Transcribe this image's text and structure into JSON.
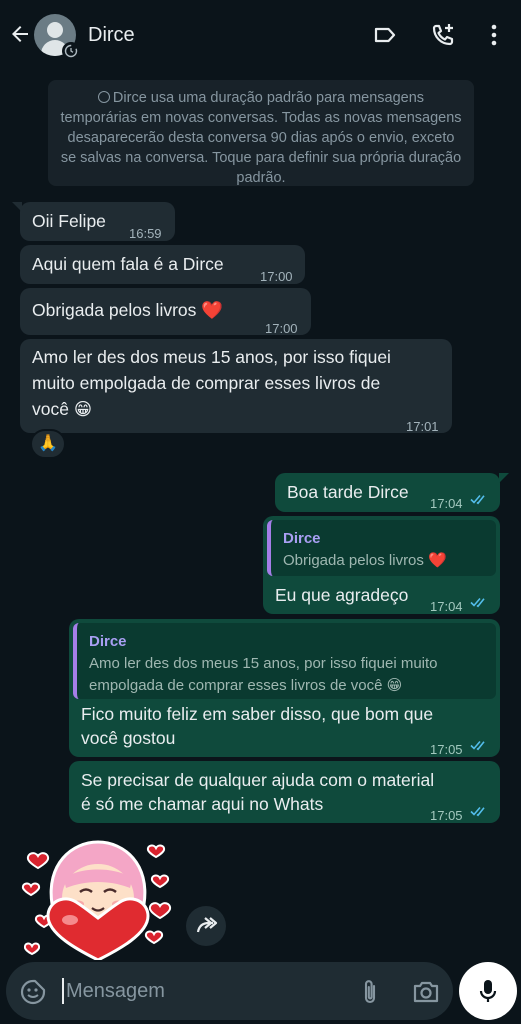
{
  "header": {
    "contact_name": "Dirce",
    "icons": [
      "back-arrow-icon",
      "label-icon",
      "add-call-icon",
      "more-vertical-icon"
    ]
  },
  "info_banner": {
    "text": "Dirce usa uma duração padrão para mensagens temporárias em novas conversas. Todas as novas mensagens desaparecerão desta conversa 90 dias após o envio, exceto se salvas na conversa. Toque para definir sua própria duração padrão."
  },
  "messages": [
    {
      "direction": "in",
      "text": "Oii Felipe",
      "time": "16:59"
    },
    {
      "direction": "in",
      "text": "Aqui quem fala é a Dirce",
      "time": "17:00"
    },
    {
      "direction": "in",
      "text": "Obrigada pelos livros ❤️",
      "time": "17:00"
    },
    {
      "direction": "in",
      "text_line1": "Amo ler des dos meus 15 anos, por isso fiquei",
      "text_line2": "muito empolgada de comprar esses livros de",
      "text_line3": "você 😁",
      "time": "17:01",
      "reaction": "🙏"
    },
    {
      "direction": "out",
      "text": "Boa tarde Dirce",
      "time": "17:04",
      "status": "read"
    },
    {
      "direction": "out",
      "quote_name": "Dirce",
      "quote_text": "Obrigada pelos livros ❤️",
      "text": "Eu que agradeço",
      "time": "17:04",
      "status": "read"
    },
    {
      "direction": "out",
      "quote_name": "Dirce",
      "quote_line1": "Amo ler des dos meus 15 anos, por isso fiquei muito",
      "quote_line2": "empolgada de comprar esses livros de você 😁",
      "text_line1": "Fico muito feliz em saber disso, que bom que",
      "text_line2": "você gostou",
      "time": "17:05",
      "status": "read"
    },
    {
      "direction": "out",
      "text_line1": "Se precisar de qualquer ajuda com o material",
      "text_line2": "é só me chamar aqui no Whats",
      "time": "17:05",
      "status": "read"
    }
  ],
  "sticker": {
    "description": "heart-hug-sticker"
  },
  "composer": {
    "placeholder": "Mensagem",
    "icons": [
      "sticker-icon",
      "attach-icon",
      "camera-icon",
      "mic-icon"
    ]
  },
  "colors": {
    "background": "#0b141a",
    "incoming_bubble": "#202c33",
    "outgoing_bubble": "#0f4a3c",
    "read_ticks": "#53bdeb",
    "quote_bar": "#a57ee8"
  }
}
